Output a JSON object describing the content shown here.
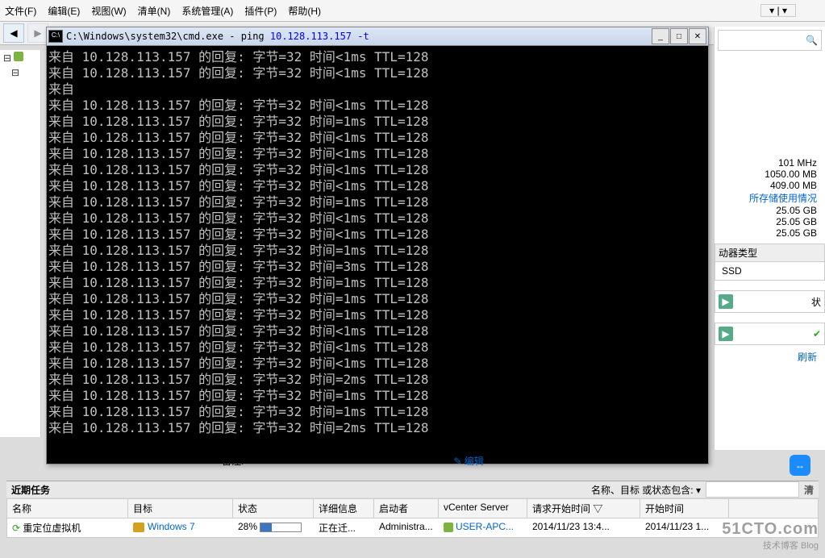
{
  "menubar": {
    "items": [
      "文件(F)",
      "编辑(E)",
      "视图(W)",
      "清单(N)",
      "系统管理(A)",
      "插件(P)",
      "帮助(H)"
    ]
  },
  "cmd": {
    "title_path": "C:\\Windows\\system32\\cmd.exe - ping ",
    "title_url": " 10.128.113.157 -t",
    "lines": [
      "来自 10.128.113.157 的回复: 字节=32 时间<1ms TTL=128",
      "来自 10.128.113.157 的回复: 字节=32 时间<1ms TTL=128",
      "来自",
      "来自 10.128.113.157 的回复: 字节=32 时间<1ms TTL=128",
      "来自 10.128.113.157 的回复: 字节=32 时间=1ms TTL=128",
      "来自 10.128.113.157 的回复: 字节=32 时间<1ms TTL=128",
      "来自 10.128.113.157 的回复: 字节=32 时间<1ms TTL=128",
      "来自 10.128.113.157 的回复: 字节=32 时间<1ms TTL=128",
      "来自 10.128.113.157 的回复: 字节=32 时间<1ms TTL=128",
      "来自 10.128.113.157 的回复: 字节=32 时间=1ms TTL=128",
      "来自 10.128.113.157 的回复: 字节=32 时间<1ms TTL=128",
      "来自 10.128.113.157 的回复: 字节=32 时间<1ms TTL=128",
      "来自 10.128.113.157 的回复: 字节=32 时间=1ms TTL=128",
      "来自 10.128.113.157 的回复: 字节=32 时间=3ms TTL=128",
      "来自 10.128.113.157 的回复: 字节=32 时间=1ms TTL=128",
      "来自 10.128.113.157 的回复: 字节=32 时间=1ms TTL=128",
      "来自 10.128.113.157 的回复: 字节=32 时间=1ms TTL=128",
      "来自 10.128.113.157 的回复: 字节=32 时间<1ms TTL=128",
      "来自 10.128.113.157 的回复: 字节=32 时间<1ms TTL=128",
      "来自 10.128.113.157 的回复: 字节=32 时间<1ms TTL=128",
      "来自 10.128.113.157 的回复: 字节=32 时间=2ms TTL=128",
      "来自 10.128.113.157 的回复: 字节=32 时间=1ms TTL=128",
      "来自 10.128.113.157 的回复: 字节=32 时间=1ms TTL=128",
      "来自 10.128.113.157 的回复: 字节=32 时间=2ms TTL=128"
    ]
  },
  "stats": {
    "mhz": "101 MHz",
    "mem_total": "1050.00 MB",
    "mem_used": "409.00 MB",
    "storage_link": "所存储使用情况",
    "gb1": "25.05 GB",
    "gb2": "25.05 GB",
    "gb3": "25.05 GB"
  },
  "driver": {
    "header": "动器类型",
    "value": "SSD"
  },
  "status_label": "状",
  "refresh": "刷新",
  "notes": {
    "label": "备注:",
    "edit": "编辑"
  },
  "recent": {
    "title": "近期任务",
    "filter_label": "名称、目标 或状态包含: ▾",
    "clear": "清"
  },
  "table": {
    "headers": {
      "name": "名称",
      "target": "目标",
      "status": "状态",
      "detail": "详细信息",
      "initiator": "启动者",
      "vcenter": "vCenter Server",
      "req_time": "请求开始时间",
      "start_time": "开始时间"
    },
    "row": {
      "name": "重定位虚拟机",
      "target": "Windows 7",
      "status_pct": "28%",
      "detail": "正在迁...",
      "initiator": "Administra...",
      "vcenter": "USER-APC...",
      "req_time": "2014/11/23 13:4...",
      "start_time": "2014/11/23 1..."
    }
  },
  "watermark": {
    "site": "51CTO.com",
    "sub": "技术博客   Blog"
  }
}
